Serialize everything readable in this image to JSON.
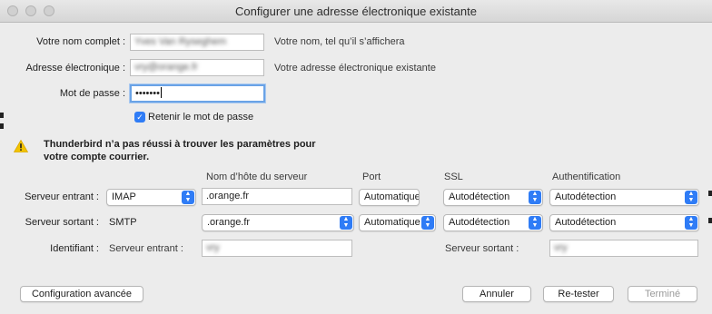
{
  "window": {
    "title": "Configurer une adresse électronique existante"
  },
  "form": {
    "name_label": "Votre nom complet :",
    "name_value": "Yves Van Ryseghem",
    "name_hint": "Votre nom, tel qu’il s’affichera",
    "email_label": "Adresse électronique :",
    "email_value": "vry@orange.fr",
    "email_hint": "Votre adresse électronique existante",
    "password_label": "Mot de passe :",
    "password_value": "•••••••",
    "remember_label": "Retenir le mot de passe"
  },
  "warning": {
    "line1": "Thunderbird n’a pas réussi à trouver les paramètres pour",
    "line2": "votre compte courrier."
  },
  "columns": {
    "host": "Nom d’hôte du serveur",
    "port": "Port",
    "ssl": "SSL",
    "auth": "Authentification"
  },
  "incoming": {
    "label": "Serveur entrant :",
    "protocol": "IMAP",
    "host": ".orange.fr",
    "port": "Automatique",
    "ssl": "Autodétection",
    "auth": "Autodétection"
  },
  "outgoing": {
    "label": "Serveur sortant :",
    "protocol": "SMTP",
    "host": ".orange.fr",
    "port": "Automatique",
    "ssl": "Autodétection",
    "auth": "Autodétection"
  },
  "identity": {
    "label": "Identifiant :",
    "incoming_label": "Serveur entrant :",
    "incoming_value": "vry",
    "outgoing_label": "Serveur sortant :",
    "outgoing_value": "vry"
  },
  "buttons": {
    "advanced": "Configuration avancée",
    "cancel": "Annuler",
    "retest": "Re-tester",
    "done": "Terminé"
  },
  "colors": {
    "accent": "#2f7cf6",
    "warning": "#f2c300"
  }
}
